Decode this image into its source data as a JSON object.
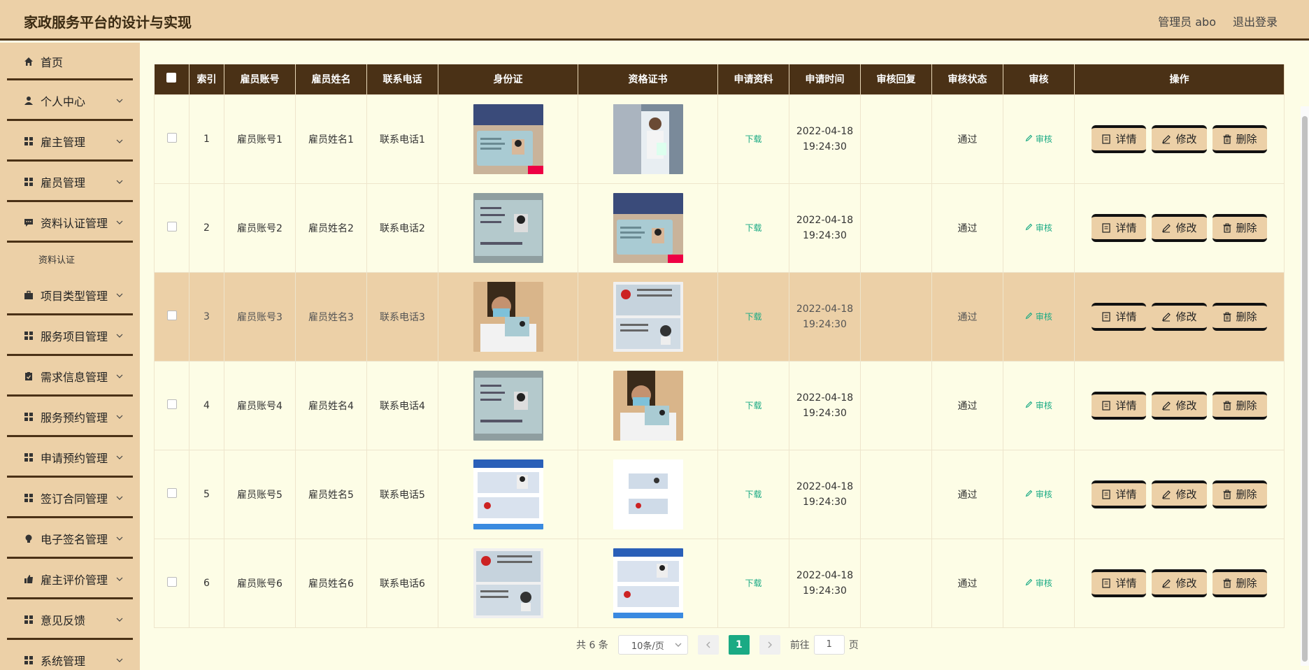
{
  "header": {
    "title": "家政服务平台的设计与实现",
    "user": "管理员 abo",
    "logout": "退出登录"
  },
  "sidebar": {
    "items": [
      {
        "label": "首页",
        "icon": "home-icon"
      },
      {
        "label": "个人中心",
        "icon": "user-icon"
      },
      {
        "label": "雇主管理",
        "icon": "grid-icon"
      },
      {
        "label": "雇员管理",
        "icon": "grid-icon"
      },
      {
        "label": "资料认证管理",
        "icon": "chat-icon"
      },
      {
        "label": "资料认证",
        "sub": true
      },
      {
        "label": "项目类型管理",
        "icon": "briefcase-icon"
      },
      {
        "label": "服务项目管理",
        "icon": "grid-icon"
      },
      {
        "label": "需求信息管理",
        "icon": "clipboard-icon"
      },
      {
        "label": "服务预约管理",
        "icon": "grid-icon"
      },
      {
        "label": "申请预约管理",
        "icon": "grid-icon"
      },
      {
        "label": "签订合同管理",
        "icon": "grid-icon"
      },
      {
        "label": "电子签名管理",
        "icon": "bulb-icon"
      },
      {
        "label": "雇主评价管理",
        "icon": "thumb-icon"
      },
      {
        "label": "意见反馈",
        "icon": "grid-icon"
      },
      {
        "label": "系统管理",
        "icon": "grid-icon"
      }
    ]
  },
  "table": {
    "headers": [
      "索引",
      "雇员账号",
      "雇员姓名",
      "联系电话",
      "身份证",
      "资格证书",
      "申请资料",
      "申请时间",
      "审核回复",
      "审核状态",
      "审核",
      "操作"
    ],
    "rows": [
      {
        "index": "1",
        "account": "雇员账号1",
        "name": "雇员姓名1",
        "phone": "联系电话1",
        "download": "下载",
        "time": "2022-04-18 19:24:30",
        "reply": "",
        "status": "通过",
        "audit": "审核"
      },
      {
        "index": "2",
        "account": "雇员账号2",
        "name": "雇员姓名2",
        "phone": "联系电话2",
        "download": "下载",
        "time": "2022-04-18 19:24:30",
        "reply": "",
        "status": "通过",
        "audit": "审核"
      },
      {
        "index": "3",
        "account": "雇员账号3",
        "name": "雇员姓名3",
        "phone": "联系电话3",
        "download": "下载",
        "time": "2022-04-18 19:24:30",
        "reply": "",
        "status": "通过",
        "audit": "审核"
      },
      {
        "index": "4",
        "account": "雇员账号4",
        "name": "雇员姓名4",
        "phone": "联系电话4",
        "download": "下载",
        "time": "2022-04-18 19:24:30",
        "reply": "",
        "status": "通过",
        "audit": "审核"
      },
      {
        "index": "5",
        "account": "雇员账号5",
        "name": "雇员姓名5",
        "phone": "联系电话5",
        "download": "下载",
        "time": "2022-04-18 19:24:30",
        "reply": "",
        "status": "通过",
        "audit": "审核"
      },
      {
        "index": "6",
        "account": "雇员账号6",
        "name": "雇员姓名6",
        "phone": "联系电话6",
        "download": "下载",
        "time": "2022-04-18 19:24:30",
        "reply": "",
        "status": "通过",
        "audit": "审核"
      }
    ],
    "actions": {
      "detail": "详情",
      "edit": "修改",
      "delete": "删除"
    }
  },
  "pager": {
    "total": "共 6 条",
    "page_size": "10条/页",
    "current": "1",
    "goto_prefix": "前往",
    "goto_value": "1",
    "goto_suffix": "页"
  },
  "colors": {
    "accent": "#ecd0a7",
    "dark": "#4a3116",
    "green": "#1aaa84",
    "bg": "#fdfde6"
  }
}
